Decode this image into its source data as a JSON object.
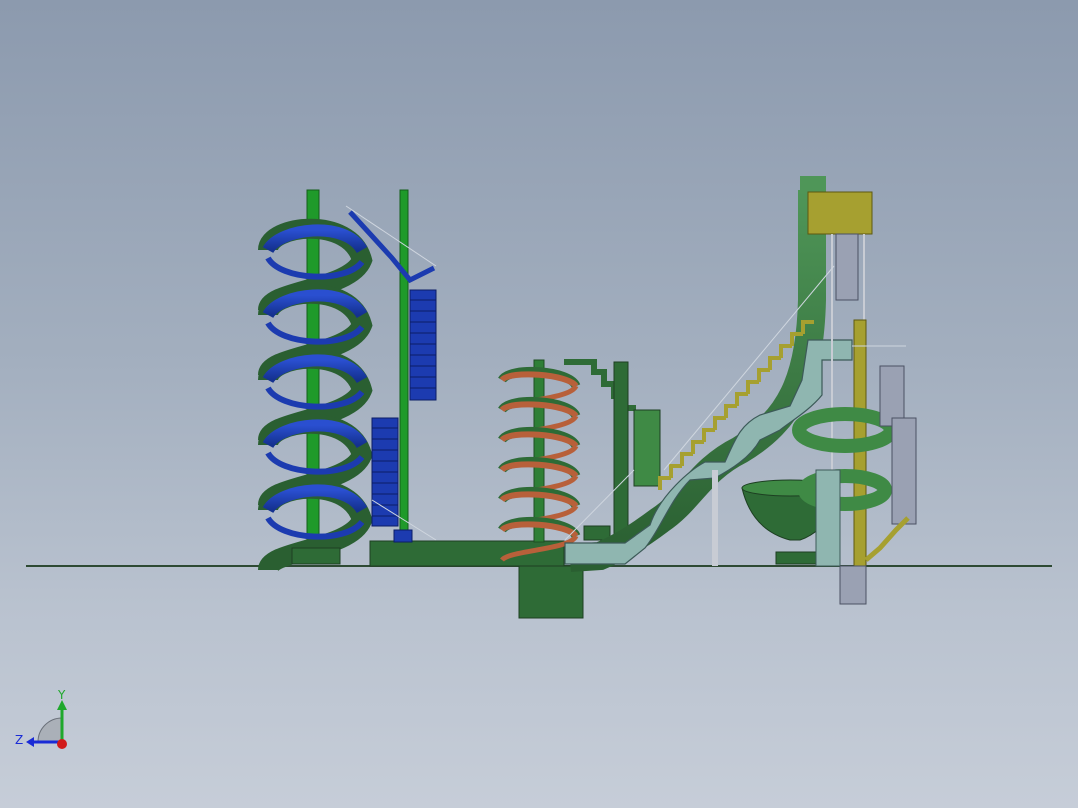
{
  "viewport": {
    "background_top": "#8c9aae",
    "background_bottom": "#c6cdd8"
  },
  "triad": {
    "y_label": "Y",
    "z_label": "Z",
    "y_color": "#1fa82c",
    "z_color": "#1a2bd6",
    "x_color": "#d11a1a"
  },
  "colors": {
    "dark_green": "#2e6b36",
    "mid_green": "#3f8a45",
    "bright_green": "#1f9a2a",
    "blue": "#1c3bb0",
    "orange": "#b8603a",
    "teal": "#8fb6b0",
    "olive": "#a6a030",
    "grey": "#9aa1b3"
  }
}
